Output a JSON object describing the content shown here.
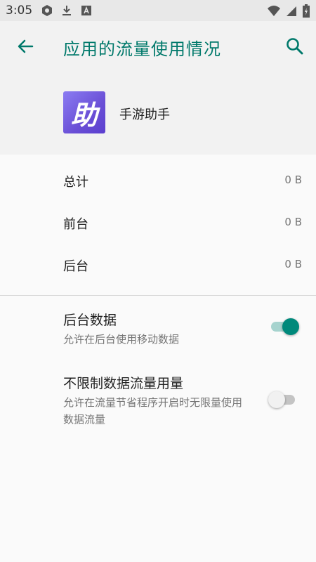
{
  "status_bar": {
    "time": "3:05",
    "left_icons": [
      "app-notification-icon",
      "download-icon",
      "font-a-icon"
    ],
    "right_icons": [
      "wifi-icon",
      "cellular-signal-icon",
      "battery-icon"
    ]
  },
  "app_bar": {
    "title": "应用的流量使用情况",
    "accent_color": "#00796b"
  },
  "app": {
    "icon_glyph": "助",
    "name": "手游助手"
  },
  "usage": [
    {
      "label": "总计",
      "value": "0 B"
    },
    {
      "label": "前台",
      "value": "0 B"
    },
    {
      "label": "后台",
      "value": "0 B"
    }
  ],
  "settings": {
    "background_data": {
      "title": "后台数据",
      "summary": "允许在后台使用移动数据",
      "enabled": true
    },
    "unrestricted_data": {
      "title": "不限制数据流量用量",
      "summary": "允许在流量节省程序开启时无限量使用数据流量",
      "enabled": false
    }
  },
  "colors": {
    "switch_on_thumb": "#00897b",
    "switch_on_track": "#a6d3ce",
    "switch_off_track": "#c4c4c4"
  }
}
